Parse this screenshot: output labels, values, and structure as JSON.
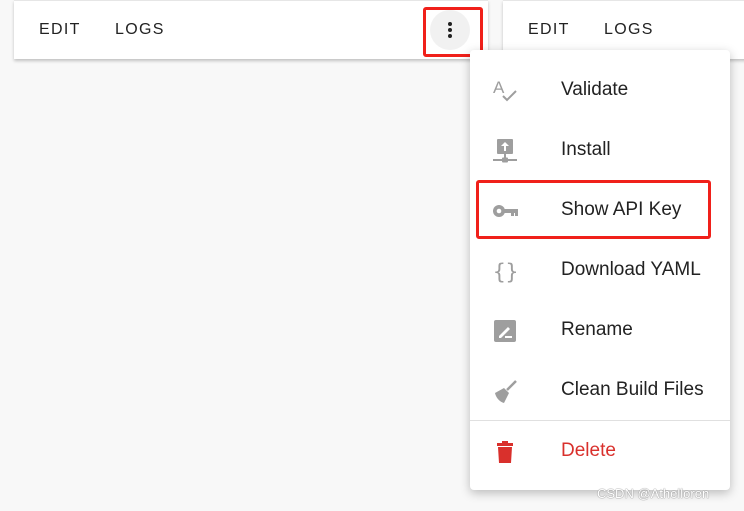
{
  "cards": [
    {
      "tabs": [
        "EDIT",
        "LOGS"
      ]
    },
    {
      "tabs": [
        "EDIT",
        "LOGS"
      ]
    }
  ],
  "menu": {
    "items": [
      {
        "label": "Validate",
        "icon": "spellcheck-icon"
      },
      {
        "label": "Install",
        "icon": "upload-network-icon"
      },
      {
        "label": "Show API Key",
        "icon": "key-icon"
      },
      {
        "label": "Download YAML",
        "icon": "code-braces-icon"
      },
      {
        "label": "Rename",
        "icon": "rename-icon"
      },
      {
        "label": "Clean Build Files",
        "icon": "broom-icon"
      },
      {
        "label": "Delete",
        "icon": "trash-icon"
      }
    ]
  },
  "colors": {
    "highlight": "#f0201a",
    "danger": "#d9302c",
    "icon": "#9e9e9e"
  },
  "watermark": "CSDN @Athelloren"
}
